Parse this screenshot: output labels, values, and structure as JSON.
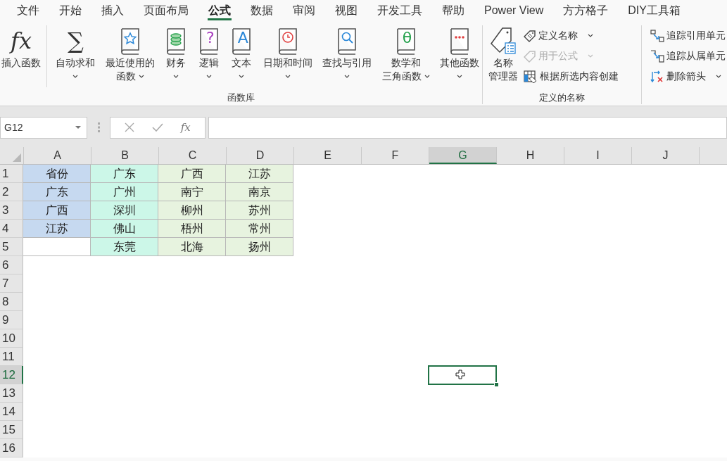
{
  "tabs": [
    {
      "label": "文件",
      "selected": false
    },
    {
      "label": "开始",
      "selected": false
    },
    {
      "label": "插入",
      "selected": false
    },
    {
      "label": "页面布局",
      "selected": false
    },
    {
      "label": "公式",
      "selected": true
    },
    {
      "label": "数据",
      "selected": false
    },
    {
      "label": "审阅",
      "selected": false
    },
    {
      "label": "视图",
      "selected": false
    },
    {
      "label": "开发工具",
      "selected": false
    },
    {
      "label": "帮助",
      "selected": false
    },
    {
      "label": "Power View",
      "selected": false
    },
    {
      "label": "方方格子",
      "selected": false
    },
    {
      "label": "DIY工具箱",
      "selected": false
    }
  ],
  "ribbon": {
    "groups": [
      {
        "label": "函数库",
        "items": [
          {
            "kind": "large",
            "lines": [
              "插入函数"
            ],
            "dropdown": false,
            "icon_text": "fx",
            "separator_after": true
          },
          {
            "kind": "large",
            "lines": [
              "自动求和"
            ],
            "dropdown": true,
            "icon_text": "∑"
          },
          {
            "kind": "large",
            "lines": [
              "最近使用的",
              "函数"
            ],
            "dropdown": true
          },
          {
            "kind": "large",
            "lines": [
              "财务"
            ],
            "dropdown": true
          },
          {
            "kind": "large",
            "lines": [
              "逻辑"
            ],
            "dropdown": true,
            "icon_text": "?"
          },
          {
            "kind": "large",
            "lines": [
              "文本"
            ],
            "dropdown": true,
            "icon_text": "A"
          },
          {
            "kind": "large",
            "lines": [
              "日期和时间"
            ],
            "dropdown": true
          },
          {
            "kind": "large",
            "lines": [
              "查找与引用"
            ],
            "dropdown": true
          },
          {
            "kind": "large",
            "lines": [
              "数学和",
              "三角函数"
            ],
            "dropdown": true,
            "icon_text": "θ"
          },
          {
            "kind": "large",
            "lines": [
              "其他函数"
            ],
            "dropdown": true
          }
        ]
      },
      {
        "label": "定义的名称",
        "items": [
          {
            "kind": "large",
            "lines": [
              "名称",
              "管理器"
            ],
            "dropdown": false
          },
          {
            "kind": "small",
            "label": "定义名称",
            "dropdown": true,
            "disabled": false
          },
          {
            "kind": "small",
            "label": "用于公式",
            "dropdown": true,
            "disabled": true
          },
          {
            "kind": "small",
            "label": "根据所选内容创建",
            "dropdown": false,
            "disabled": false
          }
        ]
      },
      {
        "items": [
          {
            "kind": "small",
            "label": "追踪引用单元",
            "disabled": false
          },
          {
            "kind": "small",
            "label": "追踪从属单元",
            "disabled": false
          },
          {
            "kind": "small",
            "label": "删除箭头",
            "dropdown": true,
            "disabled": false
          }
        ]
      }
    ]
  },
  "formula_bar": {
    "name_box": "G12",
    "fx_label": "fx"
  },
  "sheet": {
    "columns": [
      {
        "label": "A",
        "selected": false
      },
      {
        "label": "B",
        "selected": false
      },
      {
        "label": "C",
        "selected": false
      },
      {
        "label": "D",
        "selected": false
      },
      {
        "label": "E",
        "selected": false
      },
      {
        "label": "F",
        "selected": false
      },
      {
        "label": "G",
        "selected": true
      },
      {
        "label": "H",
        "selected": false
      },
      {
        "label": "I",
        "selected": false
      },
      {
        "label": "J",
        "selected": false
      }
    ],
    "rows": [
      {
        "label": "1",
        "selected": false,
        "cells": [
          {
            "text": "省份",
            "color": "#c6d9f0"
          },
          {
            "text": "广东",
            "color": "#ccf7e8"
          },
          {
            "text": "广西",
            "color": "#e7f3df"
          },
          {
            "text": "江苏",
            "color": "#e7f3df"
          }
        ]
      },
      {
        "label": "2",
        "selected": false,
        "cells": [
          {
            "text": "广东",
            "color": "#c6d9f0"
          },
          {
            "text": "广州",
            "color": "#ccf7e8"
          },
          {
            "text": "南宁",
            "color": "#e7f3df"
          },
          {
            "text": "南京",
            "color": "#e7f3df"
          }
        ]
      },
      {
        "label": "3",
        "selected": false,
        "cells": [
          {
            "text": "广西",
            "color": "#c6d9f0"
          },
          {
            "text": "深圳",
            "color": "#ccf7e8"
          },
          {
            "text": "柳州",
            "color": "#e7f3df"
          },
          {
            "text": "苏州",
            "color": "#e7f3df"
          }
        ]
      },
      {
        "label": "4",
        "selected": false,
        "cells": [
          {
            "text": "江苏",
            "color": "#c6d9f0"
          },
          {
            "text": "佛山",
            "color": "#ccf7e8"
          },
          {
            "text": "梧州",
            "color": "#e7f3df"
          },
          {
            "text": "常州",
            "color": "#e7f3df"
          }
        ]
      },
      {
        "label": "5",
        "selected": false,
        "cells": [
          {
            "color": "#ffffff"
          },
          {
            "text": "东莞",
            "color": "#ccf7e8"
          },
          {
            "text": "北海",
            "color": "#e7f3df"
          },
          {
            "text": "扬州",
            "color": "#e7f3df"
          }
        ]
      },
      {
        "label": "6",
        "selected": false
      },
      {
        "label": "7",
        "selected": false
      },
      {
        "label": "8",
        "selected": false
      },
      {
        "label": "9",
        "selected": false
      },
      {
        "label": "10",
        "selected": false
      },
      {
        "label": "11",
        "selected": false
      },
      {
        "label": "12",
        "selected": true
      },
      {
        "label": "13",
        "selected": false
      },
      {
        "label": "14",
        "selected": false
      },
      {
        "label": "15",
        "selected": false
      },
      {
        "label": "16",
        "selected": false
      }
    ]
  }
}
